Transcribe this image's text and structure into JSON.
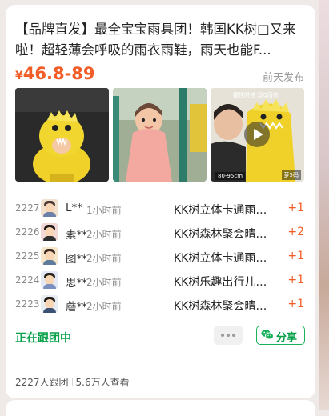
{
  "card": {
    "title": "【品牌直发】最全宝宝雨具团！韩国KK树□又来啦！超轻薄会呼吸的雨衣雨鞋，雨天也能F...",
    "price_symbol": "¥",
    "price": "46.8-89",
    "posted": "前天发布",
    "thumbnails": [
      {
        "name": "child-dino-raincoat-photo",
        "caption": ""
      },
      {
        "name": "girl-pink-raincoat-photo",
        "caption": ""
      },
      {
        "name": "dad-holding-dino-raincoat-video",
        "caption_size": "80-95cm",
        "caption_tag": "萝5码",
        "brand_text": "樱性时搭·双Q雨衣",
        "has_play": true
      }
    ],
    "orders": [
      {
        "seq": "2227",
        "user": "L**",
        "time": "1小时前",
        "product": "KK树立体卡通雨…",
        "qty": "+1"
      },
      {
        "seq": "2226",
        "user": "素**",
        "time": "2小时前",
        "product": "KK树森林聚会晴…",
        "qty": "+2"
      },
      {
        "seq": "2225",
        "user": "图**",
        "time": "2小时前",
        "product": "KK树立体卡通雨…",
        "qty": "+1"
      },
      {
        "seq": "2224",
        "user": "思**",
        "time": "2小时前",
        "product": "KK树乐趣出行儿…",
        "qty": "+1"
      },
      {
        "seq": "2223",
        "user": "蘑**",
        "time": "2小时前",
        "product": "KK树森林聚会晴…",
        "qty": "+1"
      }
    ],
    "status": "正在跟团中",
    "share_label": "分享",
    "followers": "2227人跟团",
    "views": "5.6万人查看"
  },
  "colors": {
    "accent_price": "#f25c26",
    "accent_green": "#07a14a",
    "background": "#efeae7"
  }
}
